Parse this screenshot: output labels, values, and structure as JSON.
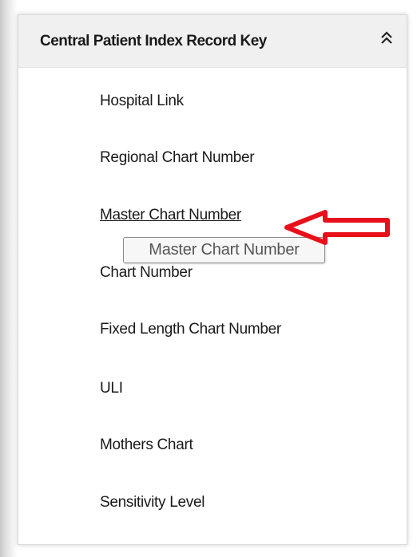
{
  "panel": {
    "title": "Central Patient Index Record Key",
    "collapse_icon": "double-chevron-up-icon"
  },
  "items": [
    {
      "label": "Hospital Link"
    },
    {
      "label": "Regional Chart Number"
    },
    {
      "label": "Master Chart Number",
      "hovered": true
    },
    {
      "label": "Chart Number"
    },
    {
      "label": "Fixed Length Chart Number"
    },
    {
      "label": "ULI"
    },
    {
      "label": "Mothers Chart"
    },
    {
      "label": "Sensitivity Level"
    }
  ],
  "tooltip": {
    "text": "Master Chart Number"
  },
  "annotation": {
    "arrow_icon": "red-arrow-left-icon",
    "color": "#e8101a"
  }
}
